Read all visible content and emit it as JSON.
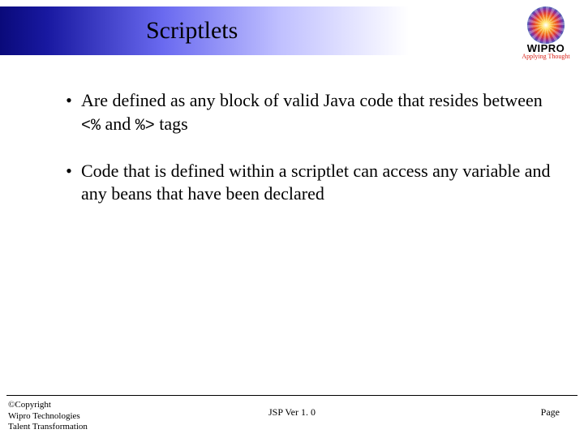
{
  "title": "Scriptlets",
  "logo": {
    "word": "WIPRO",
    "tagline": "Applying Thought"
  },
  "bullets": [
    {
      "pre": "Are defined as any block of valid Java  code that resides between  ",
      "code1": "<%",
      "mid": "   and  ",
      "code2": "%>",
      "post": " tags"
    },
    {
      "text": "Code that is defined within a scriptlet can access any variable and any beans that have been declared"
    }
  ],
  "footer": {
    "copyright": "©Copyright",
    "org": "Wipro Technologies",
    "dept": "Talent Transformation",
    "center": "JSP  Ver 1. 0",
    "page": "Page"
  }
}
